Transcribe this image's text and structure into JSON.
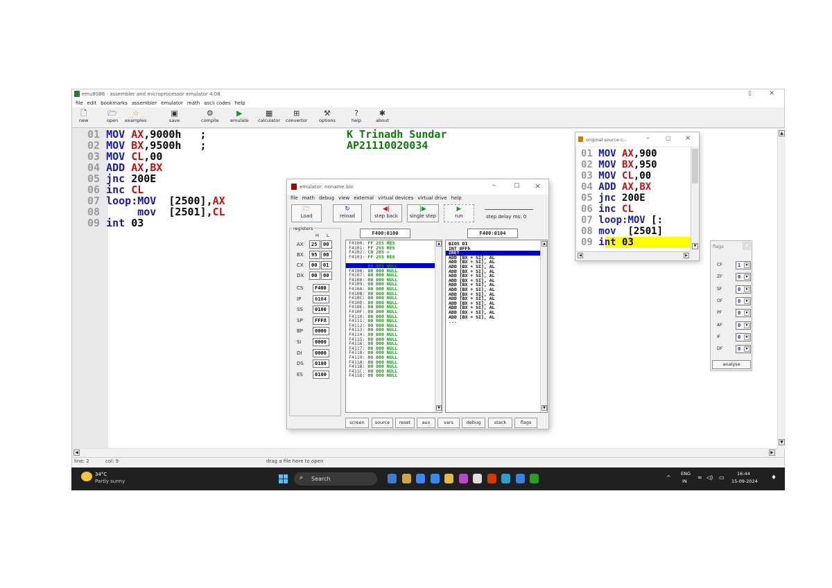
{
  "main_window": {
    "title": "emu8086 - assembler and microprocessor emulator 4.08",
    "menu": [
      "file",
      "edit",
      "bookmarks",
      "assembler",
      "emulator",
      "math",
      "ascii codes",
      "help"
    ],
    "toolbar": [
      {
        "label": "new",
        "icon": "new-file-icon"
      },
      {
        "label": "open",
        "icon": "open-folder-icon"
      },
      {
        "label": "examples",
        "icon": "examples-star-icon"
      },
      {
        "label": "save",
        "icon": "save-disk-icon"
      },
      {
        "label": "compile",
        "icon": "compile-icon"
      },
      {
        "label": "emulate",
        "icon": "play-icon"
      },
      {
        "label": "calculator",
        "icon": "calculator-icon"
      },
      {
        "label": "convertor",
        "icon": "convertor-icon"
      },
      {
        "label": "options",
        "icon": "options-tools-icon"
      },
      {
        "label": "help",
        "icon": "help-icon"
      },
      {
        "label": "about",
        "icon": "about-icon"
      }
    ],
    "code_lines": [
      {
        "num": "01",
        "tokens": [
          [
            "kw",
            "MOV "
          ],
          [
            "reg",
            "AX"
          ],
          [
            "num",
            ",9000h   ;"
          ]
        ]
      },
      {
        "num": "02",
        "tokens": [
          [
            "kw",
            "MOV "
          ],
          [
            "reg",
            "BX"
          ],
          [
            "num",
            ",9500h   ;"
          ]
        ]
      },
      {
        "num": "03",
        "tokens": [
          [
            "kw",
            "MOV "
          ],
          [
            "reg",
            "CL"
          ],
          [
            "num",
            ",00"
          ]
        ]
      },
      {
        "num": "04",
        "tokens": [
          [
            "kw",
            "ADD "
          ],
          [
            "reg",
            "AX"
          ],
          [
            "num",
            ","
          ],
          [
            "reg",
            "BX"
          ]
        ]
      },
      {
        "num": "05",
        "tokens": [
          [
            "kw",
            "jnc "
          ],
          [
            "num",
            "200E"
          ]
        ]
      },
      {
        "num": "06",
        "tokens": [
          [
            "kw",
            "inc "
          ],
          [
            "reg",
            "CL"
          ]
        ]
      },
      {
        "num": "07",
        "tokens": [
          [
            "kw",
            "loop:MOV  "
          ],
          [
            "num",
            "[2500],"
          ],
          [
            "reg",
            "AX"
          ]
        ]
      },
      {
        "num": "08",
        "tokens": [
          [
            "kw",
            "     mov  "
          ],
          [
            "num",
            "[2501],"
          ],
          [
            "reg",
            "CL"
          ]
        ]
      },
      {
        "num": "09",
        "tokens": [
          [
            "kw",
            "int "
          ],
          [
            "num",
            "03"
          ]
        ]
      }
    ],
    "comment_lines": [
      "K Trinadh Sundar",
      "AP21110020034"
    ],
    "status": {
      "line": "line: 2",
      "col": "col: 9",
      "hint": "drag a file here to open"
    }
  },
  "emulator": {
    "title": "emulator: noname.bin",
    "menu": [
      "file",
      "math",
      "debug",
      "view",
      "external",
      "virtual devices",
      "virtual drive",
      "help"
    ],
    "buttons": [
      {
        "label": "Load",
        "icon": "load-icon"
      },
      {
        "label": "reload",
        "icon": "reload-icon"
      },
      {
        "label": "step back",
        "icon": "step-back-icon"
      },
      {
        "label": "single step",
        "icon": "single-step-icon"
      },
      {
        "label": "run",
        "icon": "run-icon"
      }
    ],
    "step_delay": "step delay ms: 0",
    "registers_label": "registers",
    "h_label": "H",
    "l_label": "L",
    "regs_hl": [
      {
        "name": "AX",
        "h": "25",
        "l": "00"
      },
      {
        "name": "BX",
        "h": "95",
        "l": "00"
      },
      {
        "name": "CX",
        "h": "00",
        "l": "01"
      },
      {
        "name": "DX",
        "h": "00",
        "l": "00"
      }
    ],
    "regs_full": [
      {
        "name": "CS",
        "v": "F400"
      },
      {
        "name": "IP",
        "v": "0104"
      },
      {
        "name": "SS",
        "v": "0100"
      },
      {
        "name": "SP",
        "v": "FFF8"
      },
      {
        "name": "BP",
        "v": "0000"
      },
      {
        "name": "SI",
        "v": "0000"
      },
      {
        "name": "DI",
        "v": "0000"
      },
      {
        "name": "DS",
        "v": "0100"
      },
      {
        "name": "ES",
        "v": "0100"
      }
    ],
    "mem_address": "F400:0100",
    "dis_address": "F400:0104",
    "memory": [
      [
        "F4100:",
        "FF 255 RES"
      ],
      [
        "F4101:",
        "FF 255 RES"
      ],
      [
        "F4102:",
        "CD 205 ="
      ],
      [
        "F4103:",
        "FF 255 RES"
      ],
      [
        "F4104:",
        "CF 207 ±"
      ],
      [
        "F4105:",
        "00 000 NULL"
      ],
      [
        "F4106:",
        "00 000 NULL"
      ],
      [
        "F4107:",
        "00 000 NULL"
      ],
      [
        "F4108:",
        "00 000 NULL"
      ],
      [
        "F4109:",
        "00 000 NULL"
      ],
      [
        "F410A:",
        "00 000 NULL"
      ],
      [
        "F410B:",
        "00 000 NULL"
      ],
      [
        "F410C:",
        "00 000 NULL"
      ],
      [
        "F410D:",
        "00 000 NULL"
      ],
      [
        "F410E:",
        "00 000 NULL"
      ],
      [
        "F410F:",
        "00 000 NULL"
      ],
      [
        "F4110:",
        "00 000 NULL"
      ],
      [
        "F4111:",
        "00 000 NULL"
      ],
      [
        "F4112:",
        "00 000 NULL"
      ],
      [
        "F4113:",
        "00 000 NULL"
      ],
      [
        "F4114:",
        "00 000 NULL"
      ],
      [
        "F4115:",
        "00 000 NULL"
      ],
      [
        "F4116:",
        "00 000 NULL"
      ],
      [
        "F4117:",
        "00 000 NULL"
      ],
      [
        "F4118:",
        "00 000 NULL"
      ],
      [
        "F4119:",
        "00 000 NULL"
      ],
      [
        "F411A:",
        "00 000 NULL"
      ],
      [
        "F411B:",
        "00 000 NULL"
      ],
      [
        "F411C:",
        "00 000 NULL"
      ],
      [
        "F411D:",
        "00 000 NULL"
      ]
    ],
    "disasm": [
      "BIOS DI",
      "INT 0FFh",
      "IRET",
      "ADD [BX + SI], AL",
      "ADD [BX + SI], AL",
      "ADD [BX + SI], AL",
      "ADD [BX + SI], AL",
      "ADD [BX + SI], AL",
      "ADD [BX + SI], AL",
      "ADD [BX + SI], AL",
      "ADD [BX + SI], AL",
      "ADD [BX + SI], AL",
      "ADD [BX + SI], AL",
      "ADD [BX + SI], AL",
      "ADD [BX + SI], AL",
      "ADD [BX + SI], AL",
      "ADD [BX + SI], AL",
      "..."
    ],
    "bottom_buttons": [
      "screen",
      "source",
      "reset",
      "aux",
      "vars",
      "debug",
      "stack",
      "flags"
    ]
  },
  "source_window": {
    "title": "original source c...",
    "lines": [
      {
        "num": "01",
        "tokens": [
          [
            "kw",
            "MOV "
          ],
          [
            "reg",
            "AX"
          ],
          [
            "num",
            ",900"
          ]
        ]
      },
      {
        "num": "02",
        "tokens": [
          [
            "kw",
            "MOV "
          ],
          [
            "reg",
            "BX"
          ],
          [
            "num",
            ",950"
          ]
        ]
      },
      {
        "num": "03",
        "tokens": [
          [
            "kw",
            "MOV "
          ],
          [
            "reg",
            "CL"
          ],
          [
            "num",
            ",00"
          ]
        ]
      },
      {
        "num": "04",
        "tokens": [
          [
            "kw",
            "ADD "
          ],
          [
            "reg",
            "AX"
          ],
          [
            "num",
            ","
          ],
          [
            "reg",
            "BX"
          ]
        ]
      },
      {
        "num": "05",
        "tokens": [
          [
            "kw",
            "jnc "
          ],
          [
            "num",
            "200E"
          ]
        ]
      },
      {
        "num": "06",
        "tokens": [
          [
            "kw",
            "inc "
          ],
          [
            "reg",
            "CL"
          ]
        ]
      },
      {
        "num": "07",
        "tokens": [
          [
            "kw",
            "loop:MOV "
          ],
          [
            "num",
            "[:"
          ]
        ]
      },
      {
        "num": "08",
        "tokens": [
          [
            "kw",
            "mov  "
          ],
          [
            "num",
            "[2501]"
          ]
        ]
      },
      {
        "num": "09",
        "tokens": [
          [
            "kw",
            "int "
          ],
          [
            "num",
            "03"
          ]
        ]
      }
    ]
  },
  "flags_window": {
    "title": "flags",
    "flags": [
      {
        "name": "CF",
        "v": "1"
      },
      {
        "name": "ZF",
        "v": "0"
      },
      {
        "name": "SF",
        "v": "0"
      },
      {
        "name": "OF",
        "v": "0"
      },
      {
        "name": "PF",
        "v": "0"
      },
      {
        "name": "AF",
        "v": "0"
      },
      {
        "name": "IF",
        "v": "0"
      },
      {
        "name": "DF",
        "v": "0"
      }
    ],
    "analyse": "analyse"
  },
  "taskbar": {
    "weather_temp": "34°C",
    "weather_desc": "Partly sunny",
    "search": "Search",
    "lang": "ENG",
    "region": "IN",
    "time": "16:44",
    "date": "15-09-2024"
  },
  "colors": {
    "keyword": "#1a1aa0",
    "register": "#c01010",
    "comment": "#0a7a0a",
    "highlight": "#ffff00",
    "selection": "#0000cc"
  }
}
